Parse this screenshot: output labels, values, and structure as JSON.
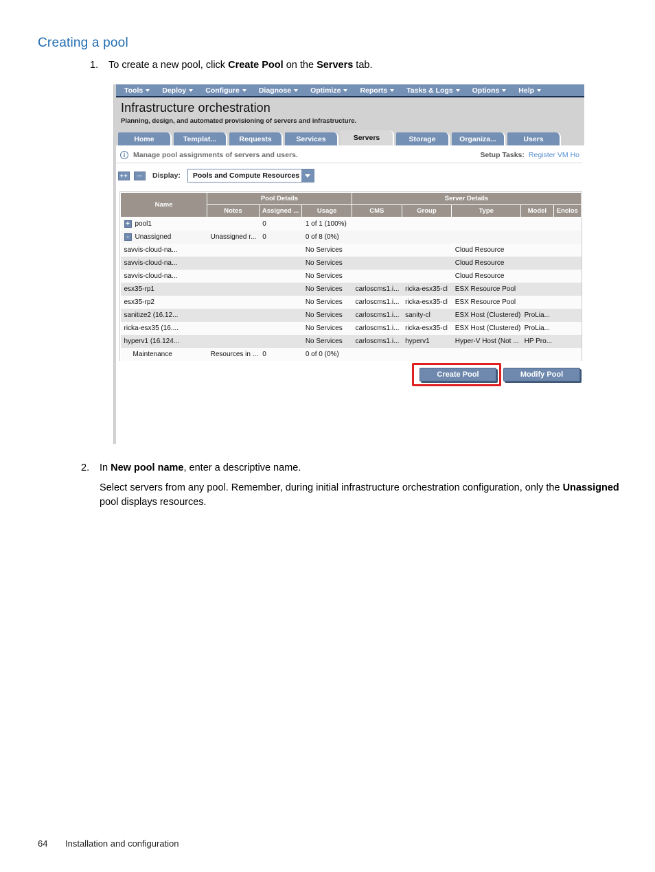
{
  "document": {
    "heading": "Creating a pool",
    "step1": {
      "number": "1.",
      "text_a": "To create a new pool, click ",
      "bold_a": "Create Pool",
      "text_b": " on the ",
      "bold_b": "Servers",
      "text_c": " tab."
    },
    "step2": {
      "number": "2.",
      "text_a": "In ",
      "bold_a": "New pool name",
      "text_b": ", enter a descriptive name.",
      "sub_a": "Select servers from any pool. Remember, during initial infrastructure orchestration configuration, only the ",
      "sub_bold": "Unassigned",
      "sub_b": " pool displays resources."
    },
    "footer": {
      "page_number": "64",
      "section": "Installation and configuration"
    }
  },
  "app": {
    "menubar": [
      {
        "label": "Tools",
        "icon": "chevron-down-icon"
      },
      {
        "label": "Deploy",
        "icon": "chevron-down-icon"
      },
      {
        "label": "Configure",
        "icon": "chevron-down-icon"
      },
      {
        "label": "Diagnose",
        "icon": "chevron-down-icon"
      },
      {
        "label": "Optimize",
        "icon": "chevron-down-icon"
      },
      {
        "label": "Reports",
        "icon": "chevron-down-icon"
      },
      {
        "label": "Tasks & Logs",
        "icon": "chevron-down-icon"
      },
      {
        "label": "Options",
        "icon": "chevron-down-icon"
      },
      {
        "label": "Help",
        "icon": "chevron-down-icon"
      }
    ],
    "title": "Infrastructure orchestration",
    "subtitle": "Planning, design, and automated provisioning of servers and infrastructure.",
    "tabs": [
      {
        "label": "Home",
        "active": false
      },
      {
        "label": "Templat...",
        "active": false
      },
      {
        "label": "Requests",
        "active": false
      },
      {
        "label": "Services",
        "active": false
      },
      {
        "label": "Servers",
        "active": true
      },
      {
        "label": "Storage",
        "active": false
      },
      {
        "label": "Organiza...",
        "active": false
      },
      {
        "label": "Users",
        "active": false
      }
    ],
    "info": {
      "icon": "info-icon",
      "text": "Manage pool assignments of servers and users.",
      "setup_label": "Setup Tasks:",
      "setup_link": "Register VM Ho"
    },
    "toolbar": {
      "expand_all": "++",
      "collapse_all": "--",
      "display_label": "Display:",
      "display_value": "Pools and Compute Resources"
    },
    "table": {
      "group_headers": [
        {
          "label": "Name",
          "span": 1
        },
        {
          "label": "Pool Details",
          "span": 3
        },
        {
          "label": "Server Details",
          "span": 6
        }
      ],
      "columns": [
        "Name",
        "Notes",
        "Assigned ...",
        "Usage",
        "CMS",
        "Group",
        "Type",
        "Model",
        "Enclos"
      ],
      "rows": [
        {
          "toggle": "+",
          "name": "pool1",
          "notes": "",
          "assigned": "0",
          "usage": "1 of 1 (100%)",
          "cms": "",
          "group": "",
          "type": "",
          "model": "",
          "enclosure": "",
          "indent": false,
          "shade": "white"
        },
        {
          "toggle": "-",
          "name": "Unassigned",
          "notes": "Unassigned r...",
          "assigned": "0",
          "usage": "0 of 8 (0%)",
          "cms": "",
          "group": "",
          "type": "",
          "model": "",
          "enclosure": "",
          "indent": false,
          "shade": "light"
        },
        {
          "toggle": "",
          "name": "savvis-cloud-na...",
          "notes": "",
          "assigned": "",
          "usage": "No Services",
          "cms": "",
          "group": "",
          "type": "Cloud Resource",
          "model": "",
          "enclosure": "",
          "indent": true,
          "shade": "white"
        },
        {
          "toggle": "",
          "name": "savvis-cloud-na...",
          "notes": "",
          "assigned": "",
          "usage": "No Services",
          "cms": "",
          "group": "",
          "type": "Cloud Resource",
          "model": "",
          "enclosure": "",
          "indent": true,
          "shade": "alt"
        },
        {
          "toggle": "",
          "name": "savvis-cloud-na...",
          "notes": "",
          "assigned": "",
          "usage": "No Services",
          "cms": "",
          "group": "",
          "type": "Cloud Resource",
          "model": "",
          "enclosure": "",
          "indent": true,
          "shade": "white"
        },
        {
          "toggle": "",
          "name": "esx35-rp1",
          "notes": "",
          "assigned": "",
          "usage": "No Services",
          "cms": "carloscms1.i...",
          "group": "ricka-esx35-cl",
          "type": "ESX Resource Pool",
          "model": "",
          "enclosure": "",
          "indent": true,
          "shade": "alt"
        },
        {
          "toggle": "",
          "name": "esx35-rp2",
          "notes": "",
          "assigned": "",
          "usage": "No Services",
          "cms": "carloscms1.i...",
          "group": "ricka-esx35-cl",
          "type": "ESX Resource Pool",
          "model": "",
          "enclosure": "",
          "indent": true,
          "shade": "white"
        },
        {
          "toggle": "",
          "name": "sanitize2 (16.12...",
          "notes": "",
          "assigned": "",
          "usage": "No Services",
          "cms": "carloscms1.i...",
          "group": "sanity-cl",
          "type": "ESX Host (Clustered)",
          "model": "ProLia...",
          "enclosure": "",
          "indent": true,
          "shade": "alt"
        },
        {
          "toggle": "",
          "name": "ricka-esx35 (16....",
          "notes": "",
          "assigned": "",
          "usage": "No Services",
          "cms": "carloscms1.i...",
          "group": "ricka-esx35-cl",
          "type": "ESX Host (Clustered)",
          "model": "ProLia...",
          "enclosure": "",
          "indent": true,
          "shade": "white"
        },
        {
          "toggle": "",
          "name": "hyperv1 (16.124...",
          "notes": "",
          "assigned": "",
          "usage": "No Services",
          "cms": "carloscms1.i...",
          "group": "hyperv1",
          "type": "Hyper-V Host (Not ...",
          "model": "HP Pro...",
          "enclosure": "",
          "indent": true,
          "shade": "alt"
        },
        {
          "toggle": "",
          "name": "Maintenance",
          "notes": "Resources in ...",
          "assigned": "0",
          "usage": "0 of 0 (0%)",
          "cms": "",
          "group": "",
          "type": "",
          "model": "",
          "enclosure": "",
          "indent": false,
          "shade": "white"
        }
      ]
    },
    "buttons": {
      "create_pool": "Create Pool",
      "modify_pool": "Modify Pool",
      "highlight_color": "#e02020"
    }
  }
}
